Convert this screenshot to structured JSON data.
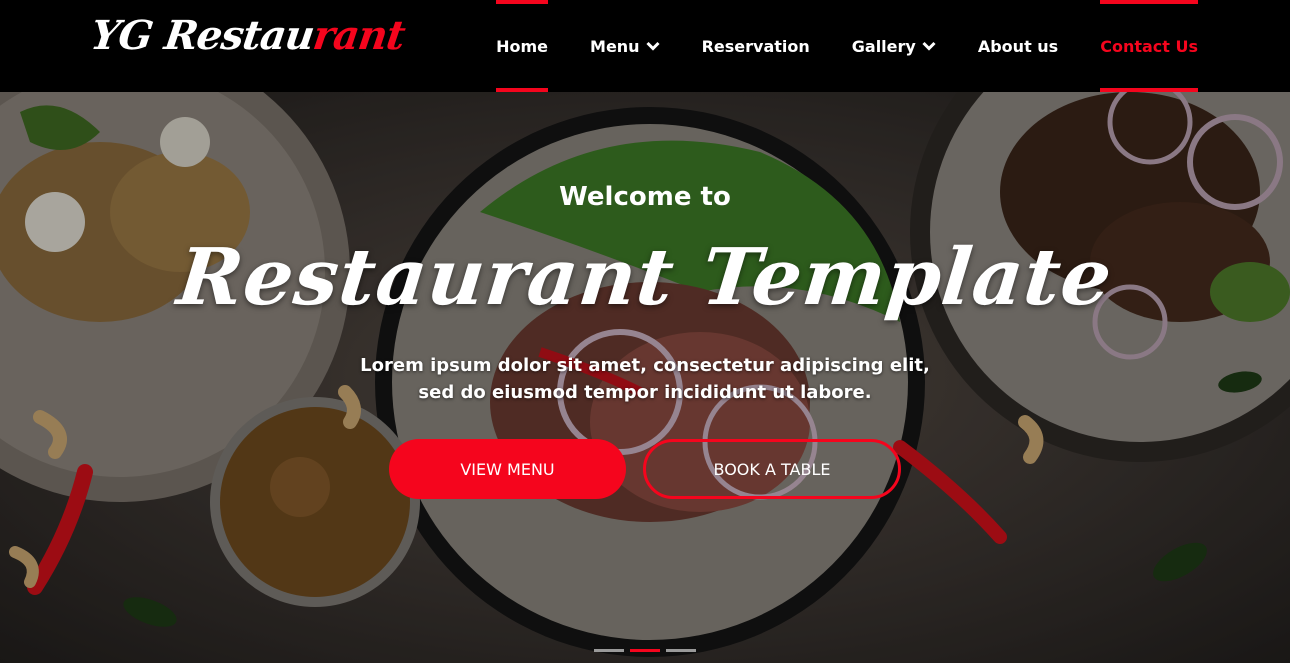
{
  "brand": {
    "logo_white": "YG Restau",
    "logo_red": "rant",
    "accent_color": "#f5051d"
  },
  "nav": {
    "items": [
      {
        "label": "Home",
        "state": "active"
      },
      {
        "label": "Menu",
        "icon": "chevron-down-icon"
      },
      {
        "label": "Reservation"
      },
      {
        "label": "Gallery",
        "icon": "chevron-down-icon"
      },
      {
        "label": "About us"
      },
      {
        "label": "Contact Us",
        "state": "highlighted"
      }
    ]
  },
  "hero": {
    "welcome": "Welcome to",
    "title": "Restaurant Template",
    "subtitle": "Lorem ipsum dolor sit amet, consectetur adipiscing elit, sed do eiusmod tempor incididunt ut labore.",
    "buttons": {
      "view_menu": "VIEW MENU",
      "book_table": "BOOK A TABLE"
    },
    "carousel": {
      "slides": 3,
      "active_index": 1
    }
  }
}
